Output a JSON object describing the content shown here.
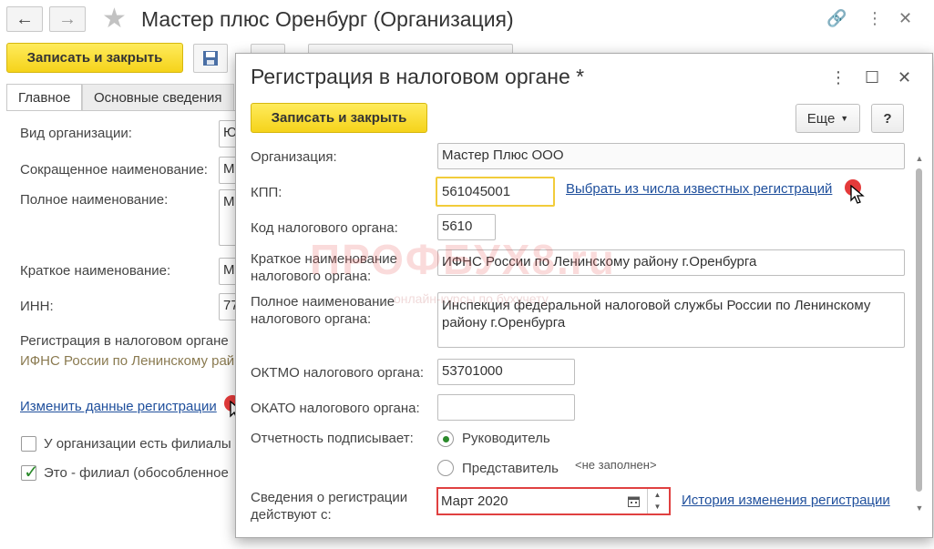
{
  "window": {
    "title": "Мастер плюс Оренбург (Организация)",
    "save_close": "Записать и закрыть"
  },
  "tabs": [
    "Главное",
    "Основные сведения"
  ],
  "bg_form": {
    "vid_label": "Вид организации:",
    "vid_value": "Ю",
    "short_name_label": "Сокращенное наименование:",
    "short_name_value": "М",
    "full_name_label": "Полное наименование:",
    "full_name_value": "М",
    "brief_name_label": "Краткое наименование:",
    "brief_name_value": "М",
    "inn_label": "ИНН:",
    "inn_value": "77",
    "reg_label": "Регистрация в налоговом органе",
    "reg_value": "ИФНС России по Ленинскому рай",
    "change_link": "Изменить данные регистрации",
    "branches_label": "У организации есть филиалы",
    "is_branch_label": "Это - филиал (обособленное"
  },
  "dialog": {
    "title": "Регистрация в налоговом органе *",
    "save_close": "Записать и закрыть",
    "more_button": "Еще",
    "help_button": "?",
    "org_label": "Организация:",
    "org_value": "Мастер Плюс ООО",
    "kpp_label": "КПП:",
    "kpp_value": "561045001",
    "choose_link": "Выбрать из числа известных регистраций",
    "code_label": "Код налогового органа:",
    "code_value": "5610",
    "short_label": "Краткое наименование налогового органа:",
    "short_value": "ИФНС России по Ленинскому району г.Оренбурга",
    "full_label": "Полное наименование налогового органа:",
    "full_value": "Инспекция федеральной налоговой службы России по Ленинскому району г.Оренбурга",
    "oktmo_label": "ОКТМО налогового органа:",
    "oktmo_value": "53701000",
    "okato_label": "ОКАТО налогового органа:",
    "okato_value": "",
    "signer_label": "Отчетность подписывает:",
    "signer_options": [
      "Руководитель",
      "Представитель"
    ],
    "signer_selected": "Руководитель",
    "not_filled": "<не заполнен>",
    "date_label": "Сведения о регистрации действуют с:",
    "date_value": "Март 2020",
    "history_link": "История изменения регистрации"
  },
  "watermark": {
    "main": "ПРОФБУХ8.ru",
    "sub": "онлайн-курсы по бухучету"
  },
  "colors": {
    "accent_yellow": "#f5d31a",
    "link_blue": "#1f4f9c",
    "highlight_red": "#e04040",
    "kpp_border": "#f2cc3a",
    "radio_green": "#2b8a2b"
  }
}
